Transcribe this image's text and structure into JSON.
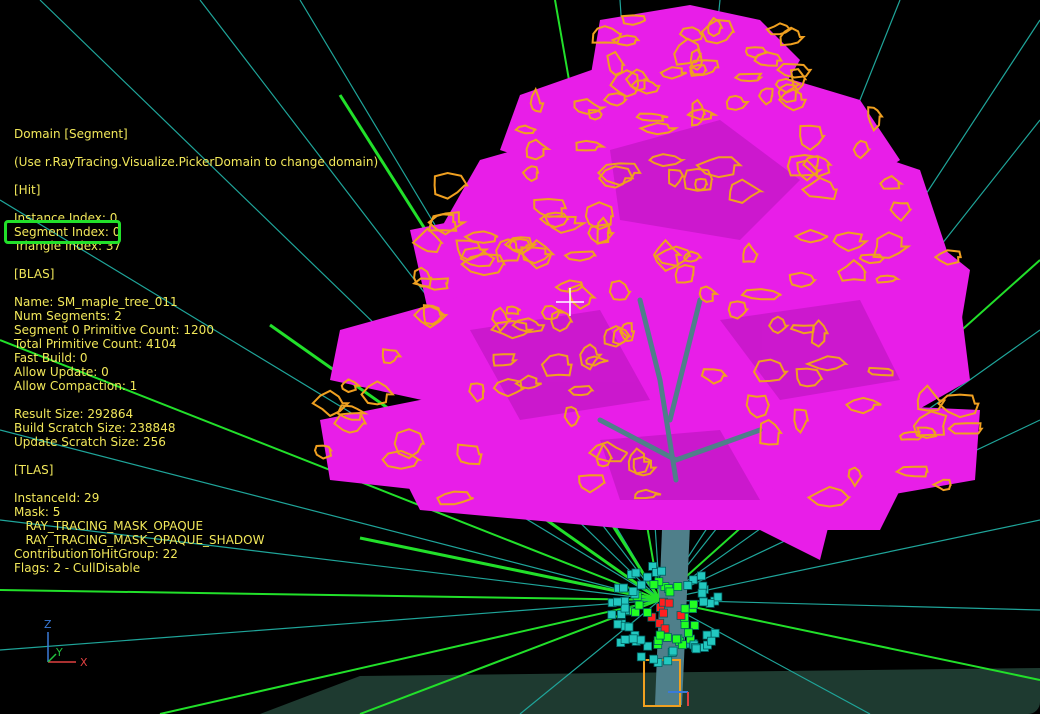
{
  "info_panel": {
    "lines": [
      "Domain [Segment]",
      "",
      "(Use r.RayTracing.Visualize.PickerDomain to change domain)",
      "",
      "[Hit]",
      "",
      "Instance Index: 0",
      "Segment Index: 0",
      "Triangle Index: 37",
      "",
      "[BLAS]",
      "",
      "Name: SM_maple_tree_011",
      "Num Segments: 2",
      "Segment 0 Primitive Count: 1200",
      "Total Primitive Count: 4104",
      "Fast Build: 0",
      "Allow Update: 0",
      "Allow Compaction: 1",
      "",
      "Result Size: 292864",
      "Build Scratch Size: 238848",
      "Update Scratch Size: 256",
      "",
      "[TLAS]",
      "",
      "InstanceId: 29",
      "Mask: 5",
      "   RAY_TRACING_MASK_OPAQUE",
      "   RAY_TRACING_MASK_OPAQUE_SHADOW",
      "ContributionToHitGroup: 22",
      "Flags: 2 - CullDisable"
    ]
  },
  "axis_gizmo": {
    "z_label": "Z",
    "y_label": "Y",
    "x_label": "X"
  },
  "colors": {
    "text": "#f2e85a",
    "highlight": "#22e02a",
    "foliage": "#e81ee8",
    "wireframe": "#f0a020",
    "ray_green": "#22e02a",
    "ray_teal": "#1fa59a",
    "trunk": "#4f7f8a"
  },
  "icons": {
    "crosshair": "crosshair-icon",
    "axis": "axis-gizmo-icon"
  }
}
